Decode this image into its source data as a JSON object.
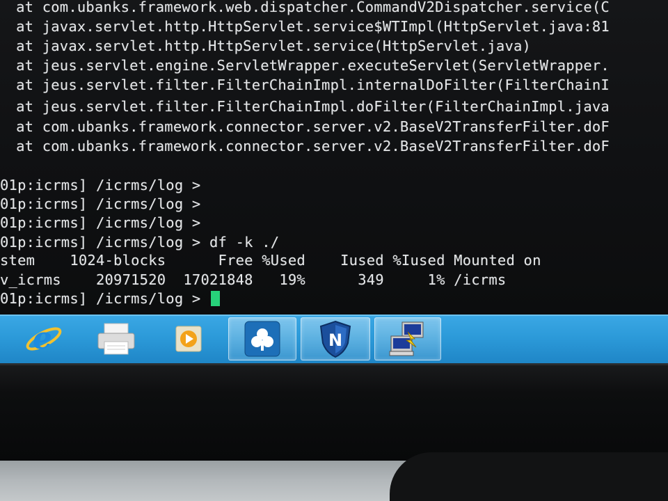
{
  "terminal": {
    "stack_trace": [
      "  at com.ubanks.framework.web.dispatcher.CommandV2Dispatcher.service(C",
      "  at javax.servlet.http.HttpServlet.service$WTImpl(HttpServlet.java:81",
      "  at javax.servlet.http.HttpServlet.service(HttpServlet.java)",
      "  at jeus.servlet.engine.ServletWrapper.executeServlet(ServletWrapper.",
      "  at jeus.servlet.filter.FilterChainImpl.internalDoFilter(FilterChainI",
      "  at jeus.servlet.filter.FilterChainImpl.doFilter(FilterChainImpl.java",
      "  at com.ubanks.framework.connector.server.v2.BaseV2TransferFilter.doF",
      "  at com.ubanks.framework.connector.server.v2.BaseV2TransferFilter.doF"
    ],
    "prompts": [
      "01p:icrms] /icrms/log >",
      "01p:icrms] /icrms/log >",
      "01p:icrms] /icrms/log >",
      "01p:icrms] /icrms/log > df -k ./"
    ],
    "df_header": "stem    1024-blocks      Free %Used    Iused %Iused Mounted on",
    "df_row": "v_icrms    20971520  17021848   19%      349     1% /icrms",
    "final_prompt": "01p:icrms] /icrms/log > ",
    "cursor_color": "#27d27a"
  },
  "taskbar": {
    "color": "#2c9ad9",
    "buttons": [
      {
        "icon": "internet-explorer-icon",
        "active": false
      },
      {
        "icon": "printer-icon",
        "active": false
      },
      {
        "icon": "media-player-icon",
        "active": false
      },
      {
        "icon": "clover-app-icon",
        "active": true
      },
      {
        "icon": "shield-n-icon",
        "active": true
      },
      {
        "icon": "network-putty-icon",
        "active": true
      }
    ]
  }
}
